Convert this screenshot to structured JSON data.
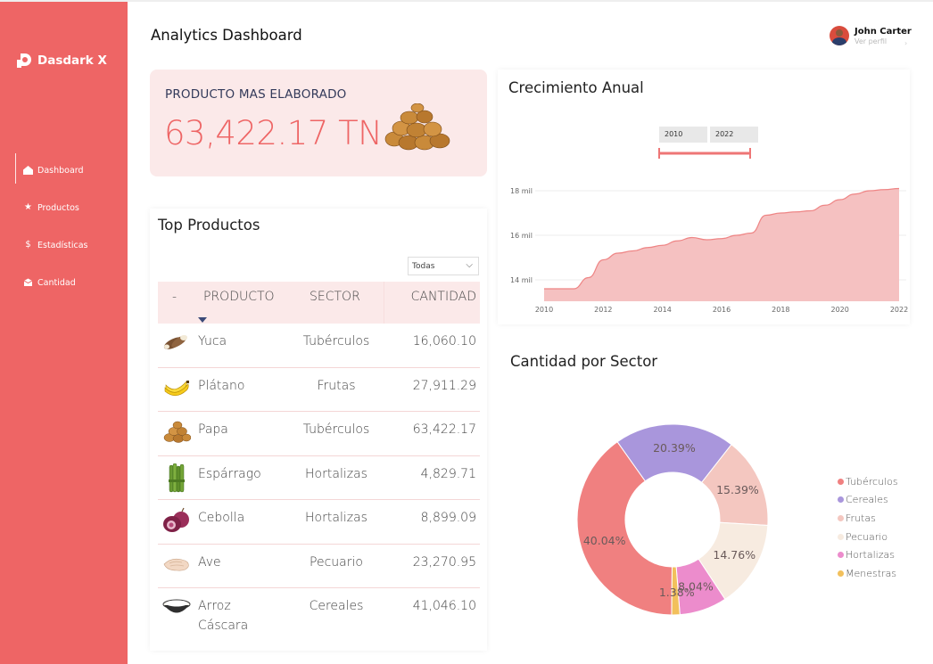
{
  "brand": {
    "name": "Dasdark X"
  },
  "sidebar": {
    "items": [
      {
        "label": "Dashboard",
        "icon": "home-icon"
      },
      {
        "label": "Productos",
        "icon": "star-icon"
      },
      {
        "label": "Estadísticas",
        "icon": "dollar-icon"
      },
      {
        "label": "Cantidad",
        "icon": "box-icon"
      }
    ]
  },
  "header": {
    "title": "Analytics Dashboard",
    "user_name": "John Carter",
    "user_link": "Ver perfil"
  },
  "highlight": {
    "label": "PRODUCTO MAS ELABORADO",
    "value": "63,422.17 TN",
    "image": "potatoes-image"
  },
  "top_products": {
    "title": "Top Productos",
    "filter_value": "Todas",
    "columns": [
      "-",
      "PRODUCTO",
      "SECTOR",
      "CANTIDAD"
    ],
    "rows": [
      {
        "image": "cassava-image",
        "name": "Yuca",
        "sector": "Tubérculos",
        "qty": "16,060.10"
      },
      {
        "image": "banana-image",
        "name": "Plátano",
        "sector": "Frutas",
        "qty": "27,911.29"
      },
      {
        "image": "potato-image",
        "name": "Papa",
        "sector": "Tubérculos",
        "qty": "63,422.17"
      },
      {
        "image": "asparagus-image",
        "name": "Espárrago",
        "sector": "Hortalizas",
        "qty": "4,829.71"
      },
      {
        "image": "onion-image",
        "name": "Cebolla",
        "sector": "Hortalizas",
        "qty": "8,899.09"
      },
      {
        "image": "chicken-image",
        "name": "Ave",
        "sector": "Pecuario",
        "qty": "23,270.95"
      },
      {
        "image": "rice-image",
        "name": "Arroz Cáscara",
        "sector": "Cereales",
        "qty": "41,046.10"
      }
    ]
  },
  "growth": {
    "title": "Crecimiento Anual",
    "range_start": "2010",
    "range_end": "2022",
    "colors": {
      "fill": "#f5c1c1",
      "line": "#ee8585"
    }
  },
  "sector": {
    "title": "Cantidad por Sector",
    "legend": [
      {
        "label": "Tubérculos",
        "color": "#f08080"
      },
      {
        "label": "Cereales",
        "color": "#a996dc"
      },
      {
        "label": "Frutas",
        "color": "#f4c7c0"
      },
      {
        "label": "Pecuario",
        "color": "#f7ebe0"
      },
      {
        "label": "Hortalizas",
        "color": "#ec8ccc"
      },
      {
        "label": "Menestras",
        "color": "#f2c05c"
      }
    ]
  },
  "chart_data": [
    {
      "type": "area",
      "title": "Crecimiento Anual",
      "x": [
        2010,
        2010.5,
        2011,
        2011.5,
        2012,
        2012.5,
        2013,
        2013.5,
        2014,
        2014.5,
        2015,
        2015.5,
        2016,
        2016.5,
        2017,
        2017.5,
        2018,
        2018.5,
        2019,
        2019.5,
        2020,
        2020.5,
        2021,
        2021.5,
        2022
      ],
      "values": [
        13.6,
        13.6,
        13.6,
        14.1,
        14.9,
        15.2,
        15.3,
        15.45,
        15.55,
        15.75,
        15.9,
        15.8,
        15.85,
        16.0,
        16.1,
        16.9,
        17.0,
        17.05,
        17.1,
        17.35,
        17.6,
        17.85,
        18.0,
        18.05,
        18.1
      ],
      "x_ticks": [
        "2010",
        "2012",
        "2014",
        "2016",
        "2018",
        "2020",
        "2022"
      ],
      "y_ticks": [
        "14 mil",
        "16 mil",
        "18 mil"
      ],
      "xlim": [
        2010,
        2022
      ],
      "ylim": [
        13,
        19
      ],
      "grid": true
    },
    {
      "type": "pie",
      "title": "Cantidad por Sector",
      "categories": [
        "Tubérculos",
        "Cereales",
        "Frutas",
        "Pecuario",
        "Hortalizas",
        "Menestras"
      ],
      "values": [
        40.04,
        20.39,
        15.39,
        14.76,
        8.04,
        1.38
      ],
      "labels": [
        "40.04%",
        "20.39%",
        "15.39%",
        "14.76%",
        "8.04%",
        "1.38%"
      ],
      "donut": true,
      "legend": "right"
    }
  ]
}
